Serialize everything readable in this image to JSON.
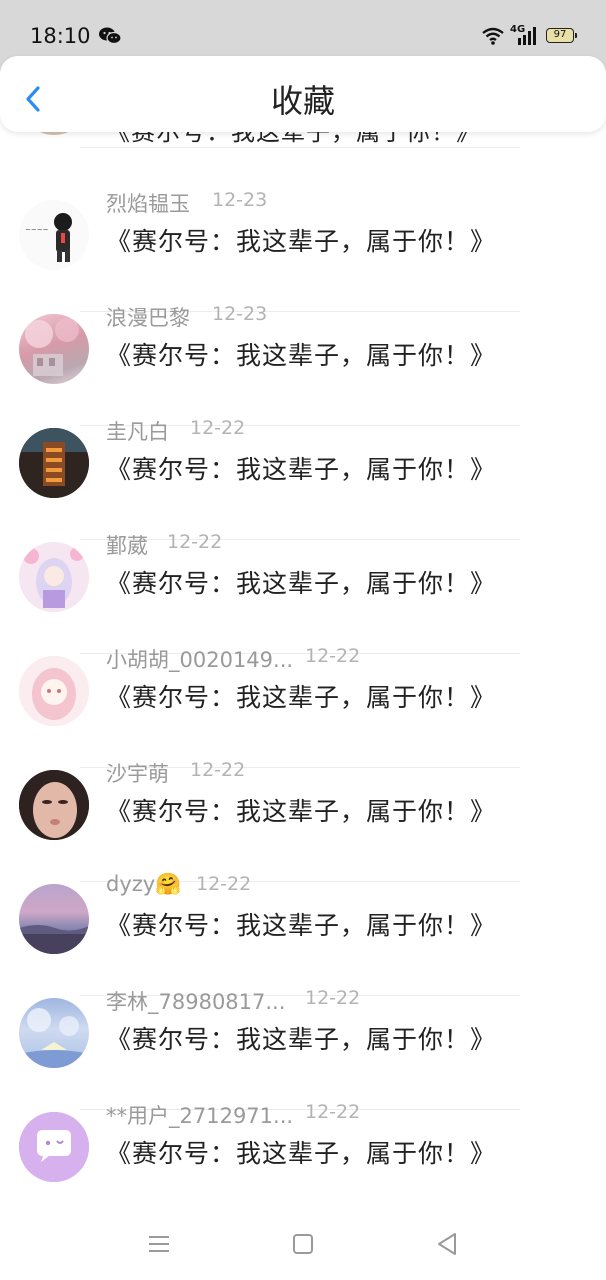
{
  "status": {
    "time": "18:10",
    "network": "4G",
    "battery": "97"
  },
  "header": {
    "title": "收藏"
  },
  "partial_item": {
    "message": "《赛尔号：我这辈子，属于你！》"
  },
  "items": [
    {
      "name": "烈焰韫玉",
      "time": "12-23",
      "message": "《赛尔号：我这辈子，属于你！》"
    },
    {
      "name": "浪漫巴黎",
      "time": "12-23",
      "message": "《赛尔号：我这辈子，属于你！》"
    },
    {
      "name": "圭凡白",
      "time": "12-22",
      "message": "《赛尔号：我这辈子，属于你！》"
    },
    {
      "name": "鄞葳",
      "time": "12-22",
      "message": "《赛尔号：我这辈子，属于你！》"
    },
    {
      "name": "小胡胡_0020149...",
      "time": "12-22",
      "message": "《赛尔号：我这辈子，属于你！》"
    },
    {
      "name": "沙宇萌",
      "time": "12-22",
      "message": "《赛尔号：我这辈子，属于你！》"
    },
    {
      "name": "dyzy🤗",
      "time": "12-22",
      "message": "《赛尔号：我这辈子，属于你！》"
    },
    {
      "name": "李林_78980817...",
      "time": "12-22",
      "message": "《赛尔号：我这辈子，属于你！》"
    },
    {
      "name": "**用户_2712971...",
      "time": "12-22",
      "message": "《赛尔号：我这辈子，属于你！》"
    }
  ],
  "icons": {
    "back": "chevron-left-icon",
    "nav_menu": "menu-icon",
    "nav_home": "square-icon",
    "nav_back": "triangle-back-icon"
  },
  "colors": {
    "accent": "#2d8cf0",
    "statusbar": "#d8d8d8"
  }
}
